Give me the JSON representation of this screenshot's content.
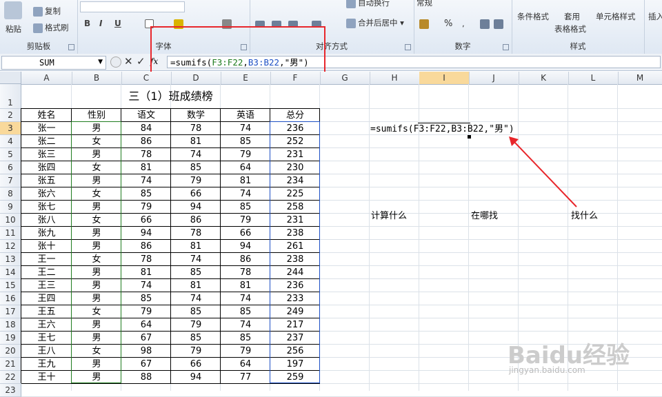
{
  "ribbon": {
    "paste_label": "粘贴",
    "copy_label": "复制",
    "format_painter_label": "格式刷",
    "clipboard_group": "剪贴板",
    "font_group": "字体",
    "align_group": "对齐方式",
    "number_group": "数字",
    "styles_group": "样式",
    "wrap_label": "自动换行",
    "merge_label": "合并后居中",
    "number_format_value": "常规",
    "cond_format_label": "条件格式",
    "table_format_label_1": "套用",
    "table_format_label_2": "表格格式",
    "cell_style_label": "单元格样式",
    "insert_label": "插入",
    "bold": "B",
    "italic": "I",
    "underline": "U"
  },
  "formula_bar": {
    "name_box": "SUM",
    "formula_prefix": "=sumifs(",
    "ref1": "F3:F22",
    "sep1": ",",
    "ref2": "B3:B22",
    "formula_suffix": ",\"男\")"
  },
  "columns": [
    "A",
    "B",
    "C",
    "D",
    "E",
    "F",
    "G",
    "H",
    "I",
    "J",
    "K",
    "L",
    "M"
  ],
  "rows": [
    "1",
    "2",
    "3",
    "4",
    "5",
    "6",
    "7",
    "8",
    "9",
    "10",
    "11",
    "12",
    "13",
    "14",
    "15",
    "16",
    "17",
    "18",
    "19",
    "20",
    "21",
    "22",
    "23"
  ],
  "sheet": {
    "title": "三（1）班成绩榜",
    "headers": [
      "姓名",
      "性别",
      "语文",
      "数学",
      "英语",
      "总分"
    ],
    "data": [
      [
        "张一",
        "男",
        "84",
        "78",
        "74",
        "236"
      ],
      [
        "张二",
        "女",
        "86",
        "81",
        "85",
        "252"
      ],
      [
        "张三",
        "男",
        "78",
        "74",
        "79",
        "231"
      ],
      [
        "张四",
        "女",
        "81",
        "85",
        "64",
        "230"
      ],
      [
        "张五",
        "男",
        "74",
        "79",
        "81",
        "234"
      ],
      [
        "张六",
        "女",
        "85",
        "66",
        "74",
        "225"
      ],
      [
        "张七",
        "男",
        "79",
        "94",
        "85",
        "258"
      ],
      [
        "张八",
        "女",
        "66",
        "86",
        "79",
        "231"
      ],
      [
        "张九",
        "男",
        "94",
        "78",
        "66",
        "238"
      ],
      [
        "张十",
        "男",
        "86",
        "81",
        "94",
        "261"
      ],
      [
        "王一",
        "女",
        "78",
        "74",
        "86",
        "238"
      ],
      [
        "王二",
        "男",
        "81",
        "85",
        "78",
        "244"
      ],
      [
        "王三",
        "男",
        "74",
        "81",
        "81",
        "236"
      ],
      [
        "王四",
        "男",
        "85",
        "74",
        "74",
        "233"
      ],
      [
        "王五",
        "女",
        "79",
        "85",
        "85",
        "249"
      ],
      [
        "王六",
        "男",
        "64",
        "79",
        "74",
        "217"
      ],
      [
        "王七",
        "男",
        "67",
        "85",
        "85",
        "237"
      ],
      [
        "王八",
        "女",
        "98",
        "79",
        "79",
        "256"
      ],
      [
        "王九",
        "男",
        "67",
        "66",
        "64",
        "197"
      ],
      [
        "王十",
        "男",
        "88",
        "94",
        "77",
        "259"
      ]
    ],
    "cell_formula": {
      "prefix": "=sumifs(",
      "ref1": "F3:F22",
      "mid": ",B3:B22,",
      "suffix": "\"男\")"
    },
    "annotations": [
      "计算什么",
      "在哪找",
      "找什么"
    ]
  },
  "watermark": {
    "brand": "Baidu经验",
    "url": "jingyan.baidu.com"
  },
  "colors": {
    "highlight_red": "#e8262b",
    "ref_green": "#1e7b1e",
    "ref_blue": "#1c4fc4",
    "selected_header": "#f9d99b"
  }
}
